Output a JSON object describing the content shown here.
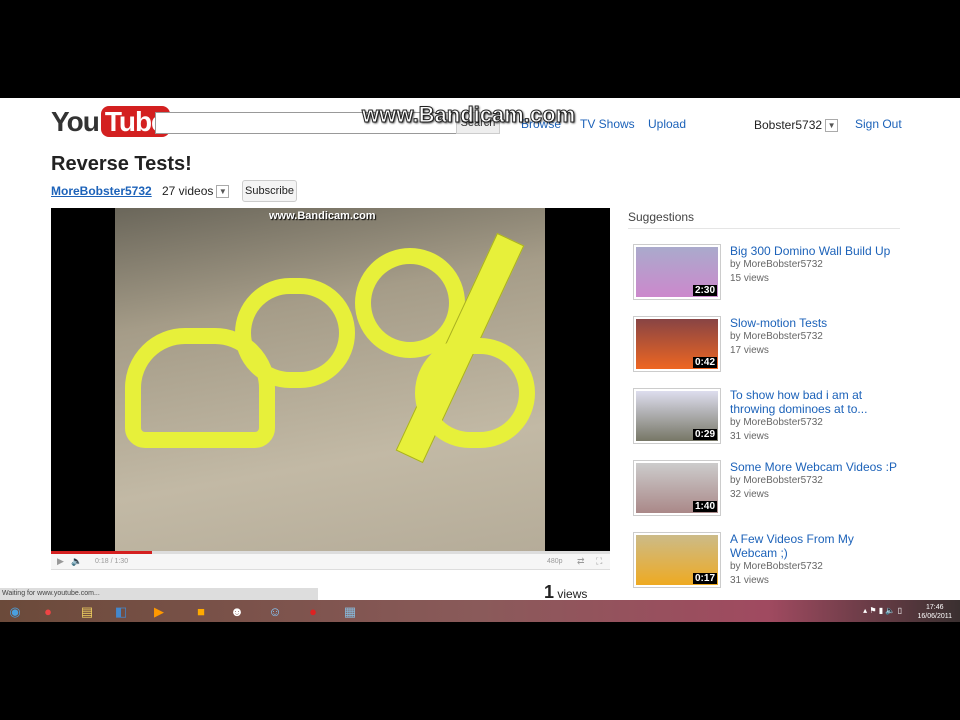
{
  "watermark": "www.Bandicam.com",
  "header": {
    "logo_you": "You",
    "logo_tube": "Tube",
    "search_value": "",
    "search_button": "Search",
    "nav": [
      "Browse",
      "TV Shows",
      "Upload"
    ],
    "user": "Bobster5732",
    "sign_out": "Sign Out"
  },
  "video": {
    "title": "Reverse Tests!",
    "channel": "MoreBobster5732",
    "video_count": "27 videos",
    "subscribe": "Subscribe",
    "overlay_watermark": "www.Bandicam.com",
    "time": "0:18 / 1:30",
    "progress_percent": 18,
    "quality": "480p",
    "views_count": "1",
    "views_label": "views"
  },
  "status_bar": "Waiting for www.youtube.com...",
  "suggestions": {
    "heading": "Suggestions",
    "items": [
      {
        "title": "Big 300 Domino Wall Build Up",
        "by": "by MoreBobster5732",
        "views": "15 views",
        "duration": "2:30"
      },
      {
        "title": "Slow-motion Tests",
        "by": "by MoreBobster5732",
        "views": "17 views",
        "duration": "0:42"
      },
      {
        "title": "To show how bad i am at throwing dominoes at to...",
        "by": "by MoreBobster5732",
        "views": "31 views",
        "duration": "0:29"
      },
      {
        "title": "Some More Webcam Videos :P",
        "by": "by MoreBobster5732",
        "views": "32 views",
        "duration": "1:40"
      },
      {
        "title": "A Few Videos From My Webcam ;)",
        "by": "by MoreBobster5732",
        "views": "31 views",
        "duration": "0:17"
      }
    ]
  },
  "taskbar": {
    "time": "17:46",
    "date": "16/06/2011"
  }
}
